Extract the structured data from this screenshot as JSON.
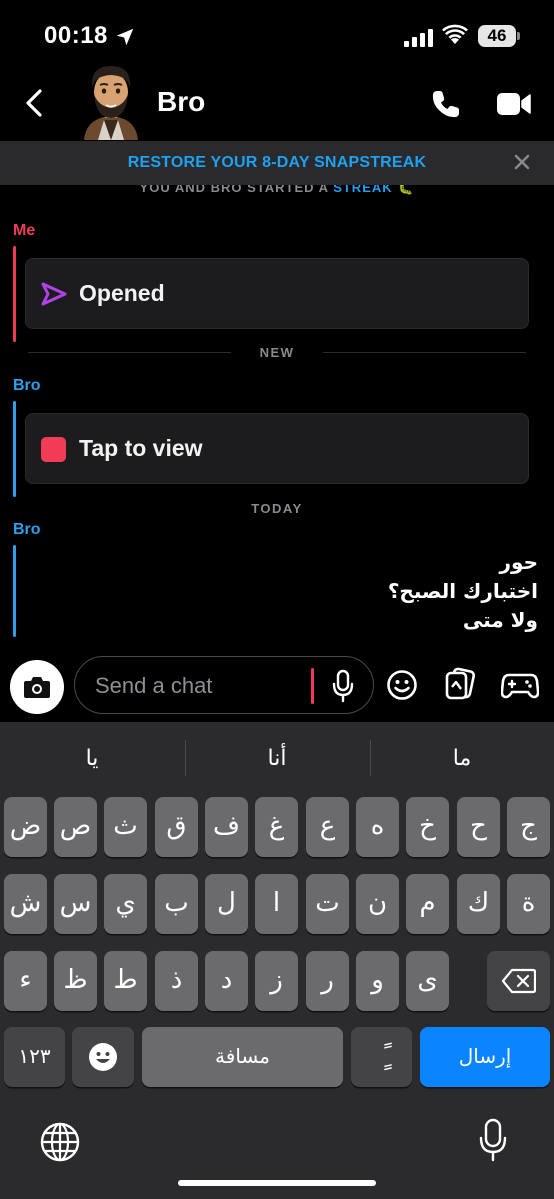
{
  "status_bar": {
    "time": "00:18",
    "battery": "46"
  },
  "header": {
    "contact_name": "Bro"
  },
  "banner": {
    "text": "RESTORE YOUR 8-DAY SNAPSTREAK"
  },
  "chat": {
    "streak_prefix": "YOU AND BRO STARTED A ",
    "streak_word": "STREAK",
    "streak_emoji": "🐛",
    "messages": [
      {
        "sender": "Me",
        "text": "Opened"
      },
      {
        "sender": "Bro",
        "text": "Tap to view"
      }
    ],
    "divider_new": "NEW",
    "divider_today": "TODAY",
    "text_message": {
      "sender": "Bro",
      "lines": [
        "حور",
        "اختبارك الصبح؟",
        "ولا متى"
      ]
    }
  },
  "chat_input": {
    "placeholder": "Send a chat"
  },
  "keyboard": {
    "suggestions": [
      "ما",
      "أنا",
      "يا"
    ],
    "row1": [
      "ج",
      "ح",
      "خ",
      "ه",
      "ع",
      "غ",
      "ف",
      "ق",
      "ث",
      "ص",
      "ض"
    ],
    "row2": [
      "ة",
      "ك",
      "م",
      "ن",
      "ت",
      "ا",
      "ل",
      "ب",
      "ي",
      "س",
      "ش"
    ],
    "row3": [
      "ى",
      "و",
      "ر",
      "ز",
      "د",
      "ذ",
      "ط",
      "ظ",
      "ء"
    ],
    "numbers_label": "١٢٣",
    "space_label": "مسافة",
    "diacritic_label": "ًٍ",
    "send_label": "إرسال"
  }
}
